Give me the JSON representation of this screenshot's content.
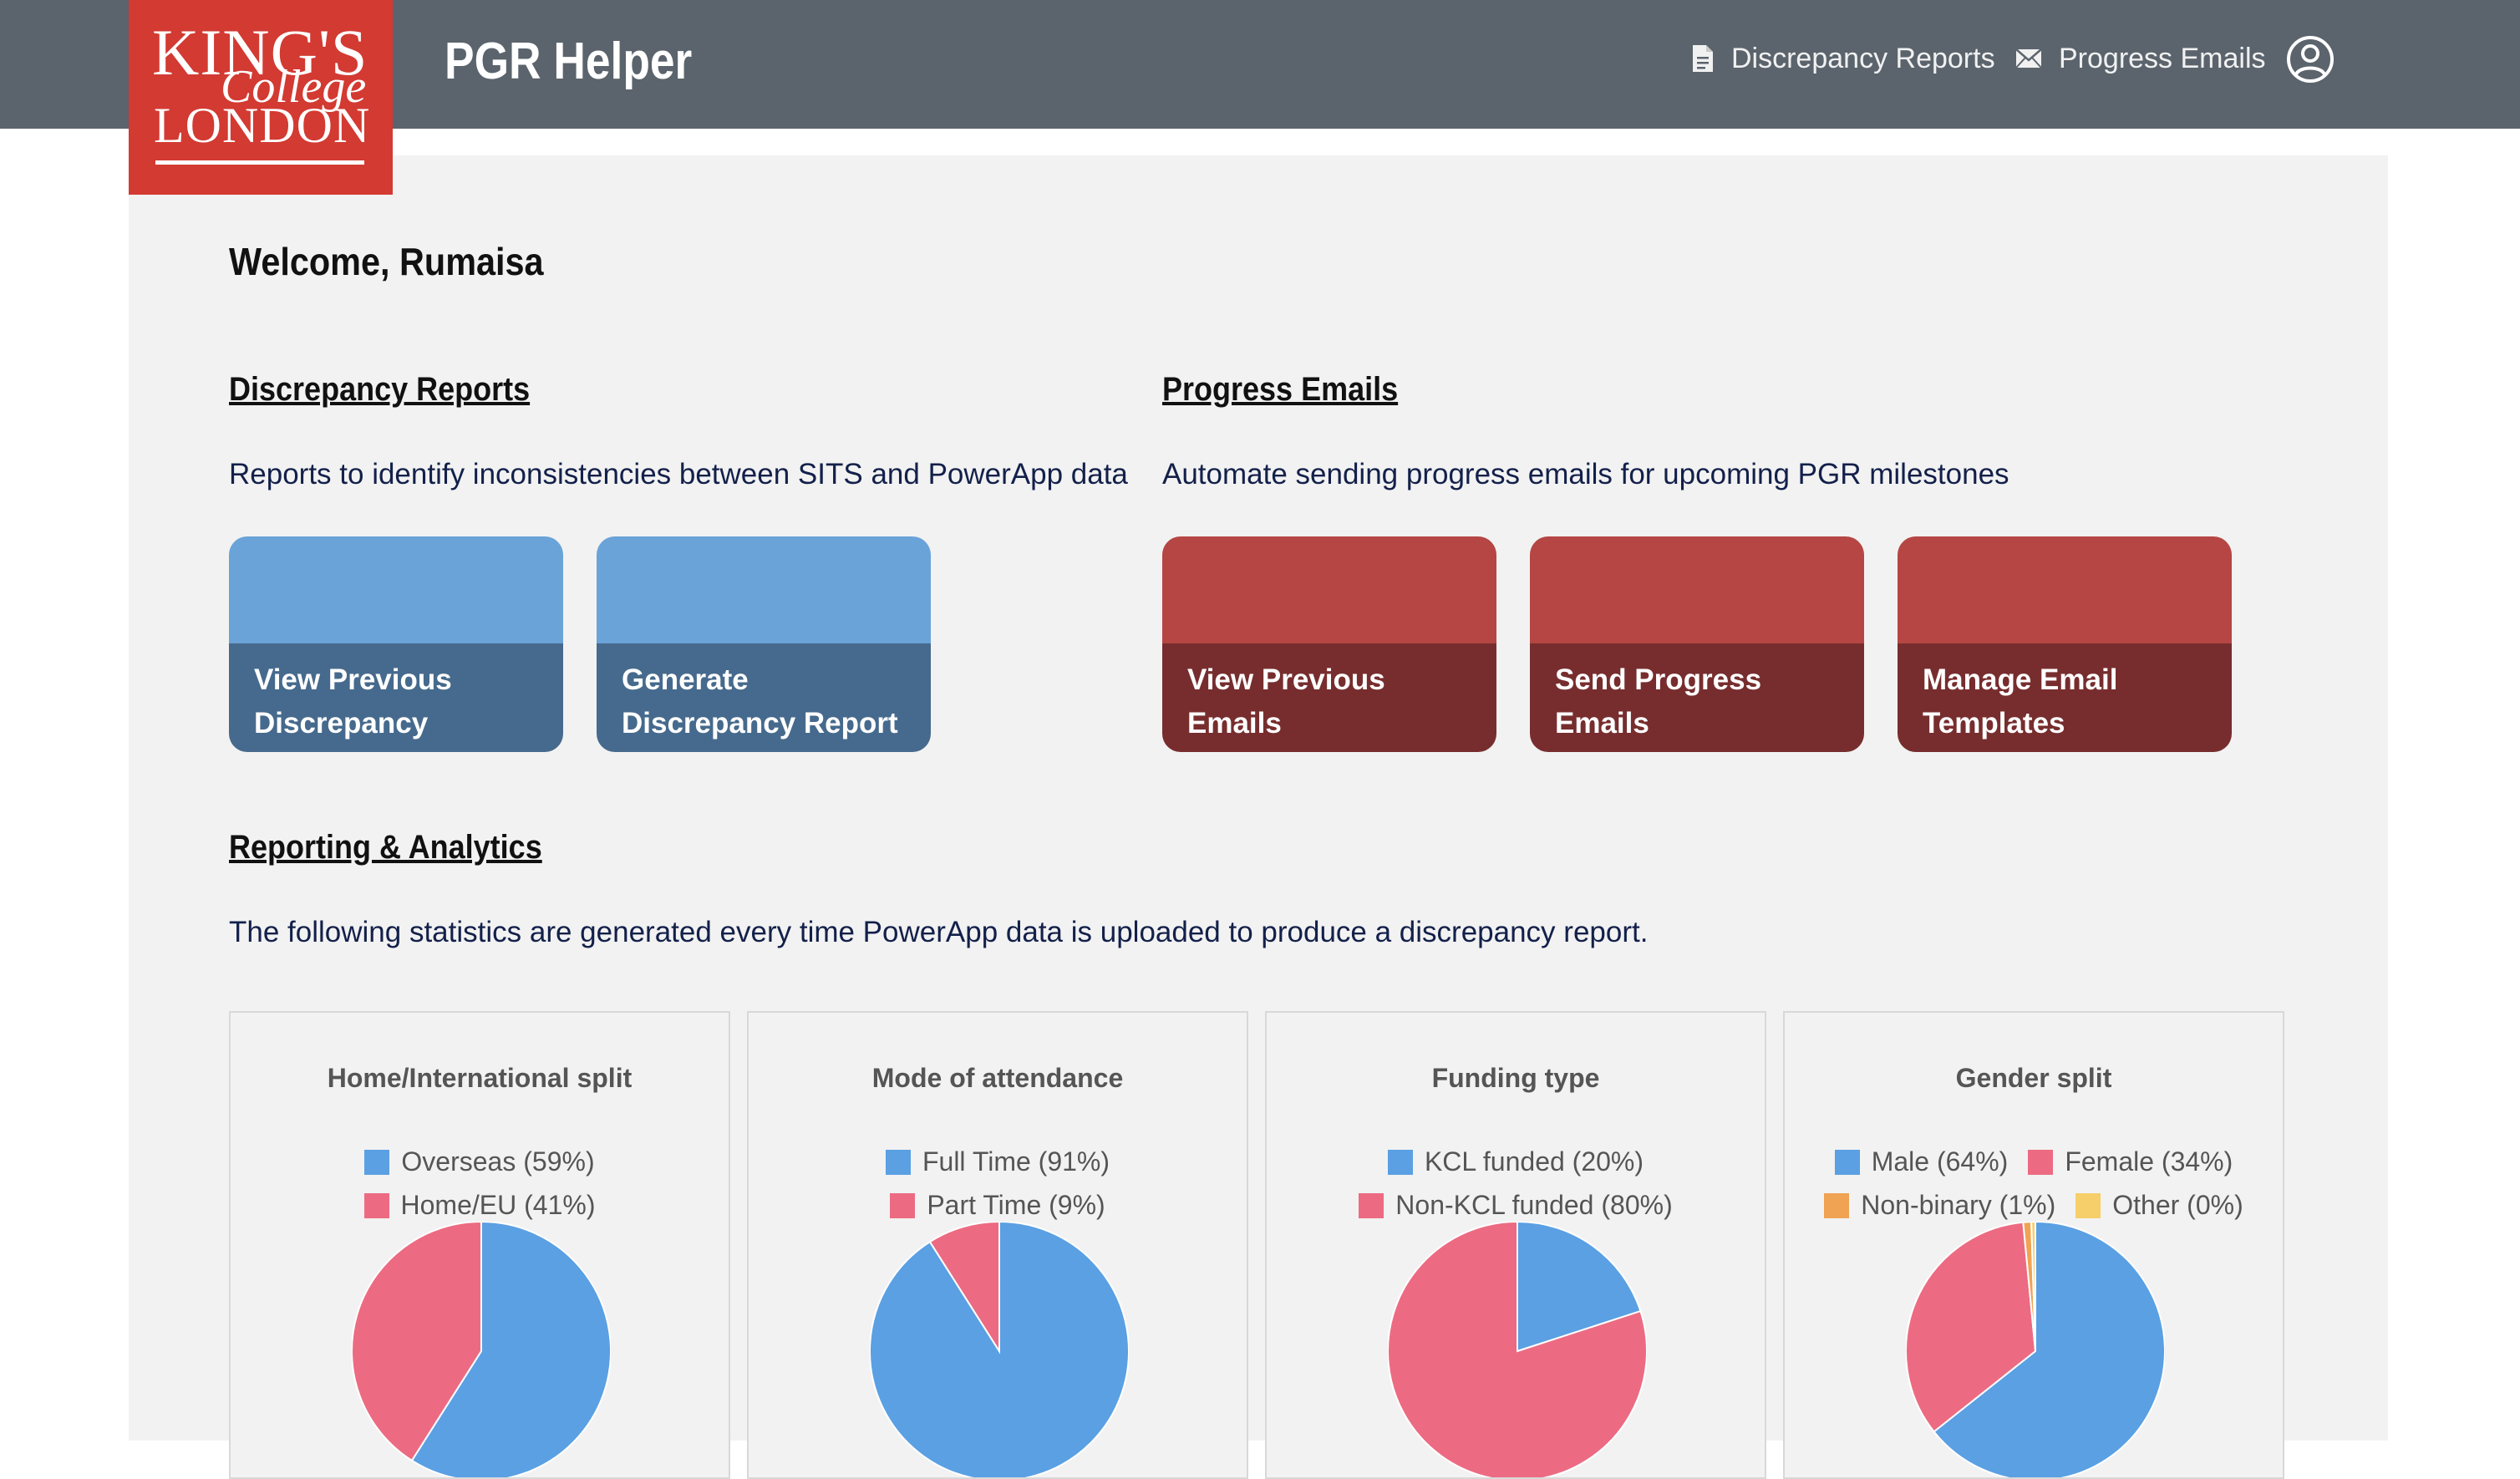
{
  "brand": {
    "logo_lines": [
      "KING'S",
      "College",
      "LONDON"
    ],
    "app_title": "PGR Helper"
  },
  "nav": {
    "discrepancy_label": "Discrepancy Reports",
    "progress_label": "Progress Emails",
    "account_icon": "user-circle-icon"
  },
  "welcome": "Welcome, Rumaisa",
  "discrepancy": {
    "heading": "Discrepancy Reports",
    "description": "Reports to identify inconsistencies between SITS and PowerApp data",
    "cards": [
      {
        "line1": "View Previous",
        "line2": "Discrepancy Reports"
      },
      {
        "line1": "Generate",
        "line2": "Discrepancy Report"
      }
    ]
  },
  "progress": {
    "heading": "Progress Emails",
    "description": "Automate sending progress emails for upcoming PGR milestones",
    "cards": [
      {
        "line1": "View Previous Emails",
        "line2": ""
      },
      {
        "line1": "Send Progress Emails",
        "line2": ""
      },
      {
        "line1": "Manage Email",
        "line2": "Templates"
      }
    ]
  },
  "analytics": {
    "heading": "Reporting & Analytics",
    "description": "The following statistics are generated every time PowerApp data is uploaded to produce a discrepancy report."
  },
  "colors": {
    "blue": "#5aa0e3",
    "pink": "#ec6b82",
    "orange": "#f0a353",
    "yellow": "#f6cf6a"
  },
  "chart_data": [
    {
      "type": "pie",
      "title": "Home/International split",
      "labels": [
        "Overseas (59%)",
        "Home/EU (41%)"
      ],
      "values": [
        59,
        41
      ],
      "colors": [
        "#5aa0e3",
        "#ec6b82"
      ]
    },
    {
      "type": "pie",
      "title": "Mode of attendance",
      "labels": [
        "Full Time (91%)",
        "Part Time (9%)"
      ],
      "values": [
        91,
        9
      ],
      "colors": [
        "#5aa0e3",
        "#ec6b82"
      ]
    },
    {
      "type": "pie",
      "title": "Funding type",
      "labels": [
        "KCL funded (20%)",
        "Non-KCL funded (80%)"
      ],
      "values": [
        20,
        80
      ],
      "colors": [
        "#5aa0e3",
        "#ec6b82"
      ]
    },
    {
      "type": "pie",
      "title": "Gender split",
      "labels": [
        "Male (64%)",
        "Female (34%)",
        "Non-binary (1%)",
        "Other (0%)"
      ],
      "values": [
        64,
        34,
        1,
        0.5
      ],
      "colors": [
        "#5aa0e3",
        "#ec6b82",
        "#f0a353",
        "#f6cf6a"
      ]
    }
  ]
}
